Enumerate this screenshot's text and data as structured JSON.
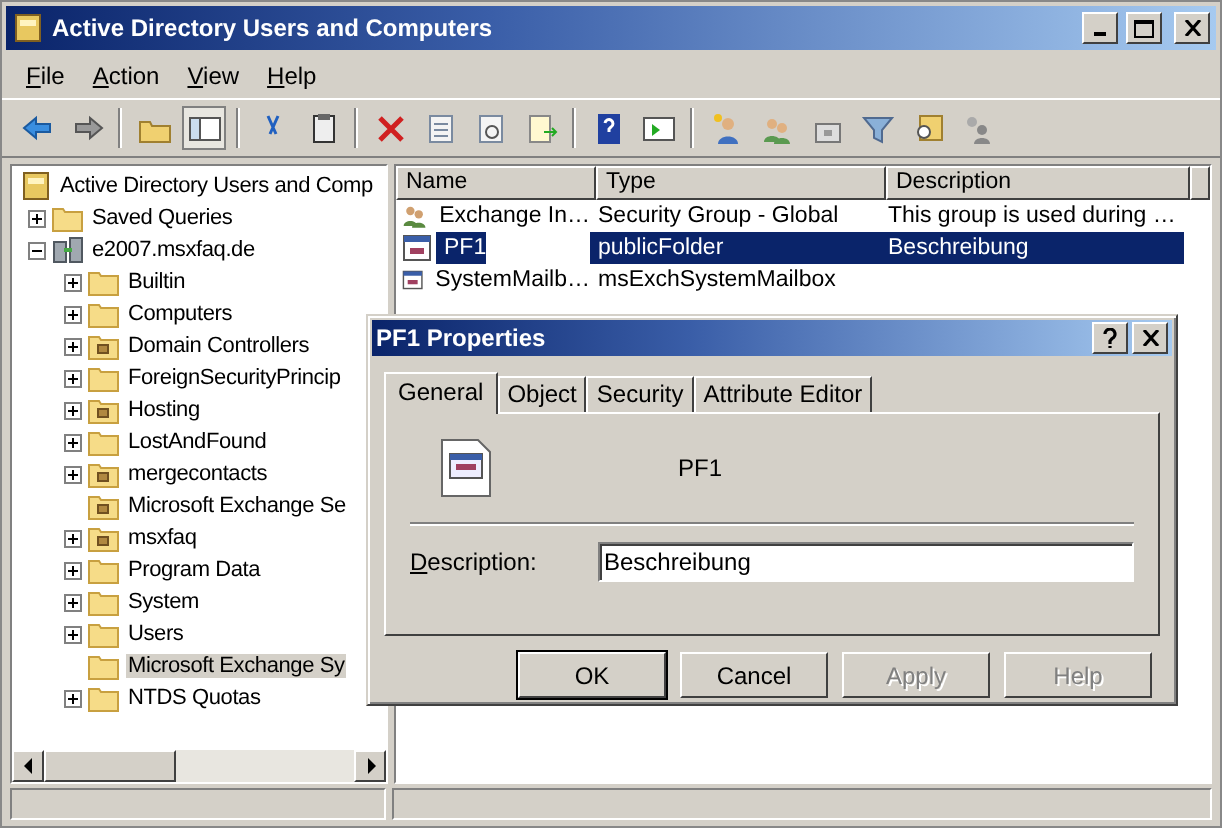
{
  "window": {
    "title": "Active Directory Users and Computers"
  },
  "menu": [
    "File",
    "Action",
    "View",
    "Help"
  ],
  "tree": {
    "label": "Active Directory Users and Comp",
    "kind": "root",
    "children": [
      {
        "label": "Saved Queries",
        "kind": "folder",
        "expanded": false,
        "selected": false
      },
      {
        "label": "e2007.msxfaq.de",
        "kind": "domain",
        "expanded": true,
        "selected": false,
        "children": [
          {
            "label": "Builtin",
            "kind": "folder",
            "expanded": false,
            "selected": false
          },
          {
            "label": "Computers",
            "kind": "folder",
            "expanded": false,
            "selected": false
          },
          {
            "label": "Domain Controllers",
            "kind": "ou",
            "expanded": false,
            "selected": false
          },
          {
            "label": "ForeignSecurityPrincip",
            "kind": "folder",
            "expanded": false,
            "selected": false
          },
          {
            "label": "Hosting",
            "kind": "ou",
            "expanded": false,
            "selected": false
          },
          {
            "label": "LostAndFound",
            "kind": "folder",
            "expanded": false,
            "selected": false
          },
          {
            "label": "mergecontacts",
            "kind": "ou",
            "expanded": false,
            "selected": false
          },
          {
            "label": "Microsoft Exchange Se",
            "kind": "ou",
            "selected": false
          },
          {
            "label": "msxfaq",
            "kind": "ou",
            "expanded": false,
            "selected": false
          },
          {
            "label": "Program Data",
            "kind": "folder",
            "expanded": false,
            "selected": false
          },
          {
            "label": "System",
            "kind": "folder",
            "expanded": false,
            "selected": false
          },
          {
            "label": "Users",
            "kind": "folder",
            "expanded": false,
            "selected": false
          },
          {
            "label": "Microsoft Exchange Sy",
            "kind": "folder",
            "selected": true
          },
          {
            "label": "NTDS Quotas",
            "kind": "folder",
            "expanded": false,
            "selected": false
          }
        ]
      }
    ]
  },
  "table": {
    "columns": [
      "Name",
      "Type",
      "Description"
    ],
    "rows": [
      {
        "kind": "group",
        "name": "Exchange In…",
        "type": "Security Group - Global",
        "description": "This group is used during …",
        "selected": false
      },
      {
        "kind": "object",
        "name": "PF1",
        "type": "publicFolder",
        "description": "Beschreibung",
        "selected": true
      },
      {
        "kind": "object",
        "name": "SystemMailb…",
        "type": "msExchSystemMailbox",
        "selected": false
      }
    ]
  },
  "dialog": {
    "title": "PF1 Properties",
    "tabs": [
      {
        "label": "General",
        "selected": true
      },
      {
        "label": "Object",
        "selected": false
      },
      {
        "label": "Security",
        "selected": false
      },
      {
        "label": "Attribute Editor",
        "selected": false
      }
    ],
    "object_name": "PF1",
    "field_label": "Description:",
    "field_value": "Beschreibung",
    "buttons": [
      {
        "label": "OK",
        "default": true,
        "disabled": false
      },
      {
        "label": "Cancel",
        "default": false,
        "disabled": false
      },
      {
        "label": "Apply",
        "default": false,
        "disabled": true
      },
      {
        "label": "Help",
        "default": false,
        "disabled": true
      }
    ]
  }
}
